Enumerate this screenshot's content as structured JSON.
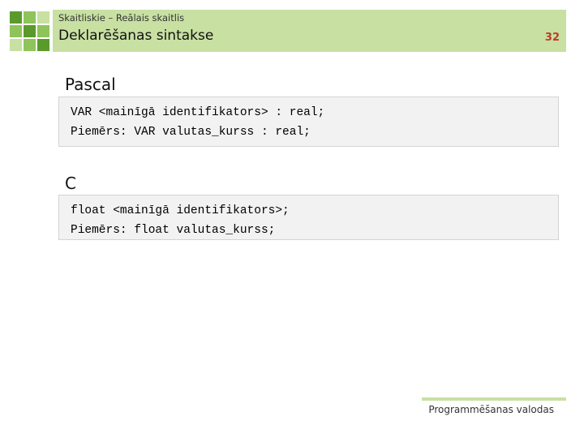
{
  "header": {
    "breadcrumb": "Skaitliskie – Reālais skaitlis",
    "title": "Deklarēšanas sintakse",
    "slide_number": "32"
  },
  "sections": [
    {
      "heading": "Pascal",
      "code_lines": [
        "VAR <mainīgā identifikators> : real;",
        "Piemērs: VAR valutas_kurss : real;"
      ]
    },
    {
      "heading": "C",
      "code_lines": [
        "float <mainīgā identifikators>;",
        "Piemērs: float valutas_kurss;"
      ]
    }
  ],
  "footer": {
    "text": "Programmēšanas valodas"
  },
  "colors": {
    "header_band": "#c8e0a2",
    "logo_dark": "#5a9a2a",
    "logo_mid": "#8fc45a",
    "logo_light": "#c8e0a2",
    "slide_number": "#c0392b",
    "code_background": "#f2f2f2"
  },
  "icons": [
    "logo-grid-icon"
  ]
}
